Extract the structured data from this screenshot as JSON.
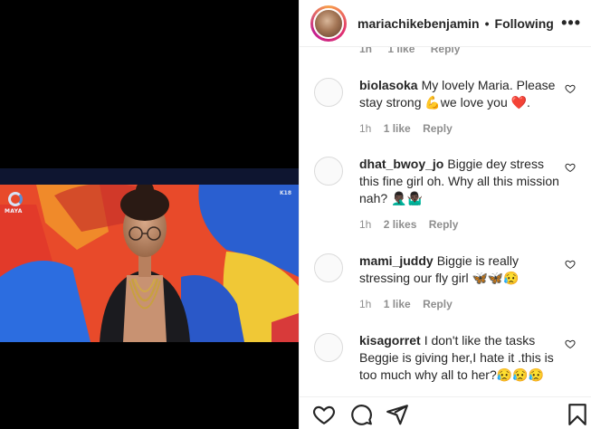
{
  "post": {
    "username": "mariachikebenjamin",
    "separator": "•",
    "follow_status": "Following",
    "more_label": "•••",
    "video_logo_text": "MAYA",
    "video_corner_tag": "K18"
  },
  "previous_meta": {
    "time": "1h",
    "likes": "1 like",
    "reply": "Reply"
  },
  "comments": [
    {
      "username": "biolasoka",
      "text": "My lovely Maria. Please stay strong 💪we love you ❤️.",
      "time": "1h",
      "likes": "1 like",
      "reply": "Reply"
    },
    {
      "username": "dhat_bwoy_jo",
      "text": "Biggie dey stress this fine girl oh. Why all this mission nah? 🤦🏿‍♂️🤷🏿‍♂️",
      "time": "1h",
      "likes": "2 likes",
      "reply": "Reply"
    },
    {
      "username": "mami_juddy",
      "text": "Biggie is really stressing our fly girl 🦋🦋😥",
      "time": "1h",
      "likes": "1 like",
      "reply": "Reply"
    },
    {
      "username": "kisagorret",
      "text": "I don't like the tasks Beggie is giving her,I hate it .this is too much why all to her?😥😥😥",
      "time": "",
      "likes": "",
      "reply": ""
    }
  ],
  "icons": {
    "like": "heart-icon",
    "comment": "comment-bubble-icon",
    "share": "paper-plane-icon",
    "save": "bookmark-icon",
    "comment_like": "small-heart-icon"
  }
}
